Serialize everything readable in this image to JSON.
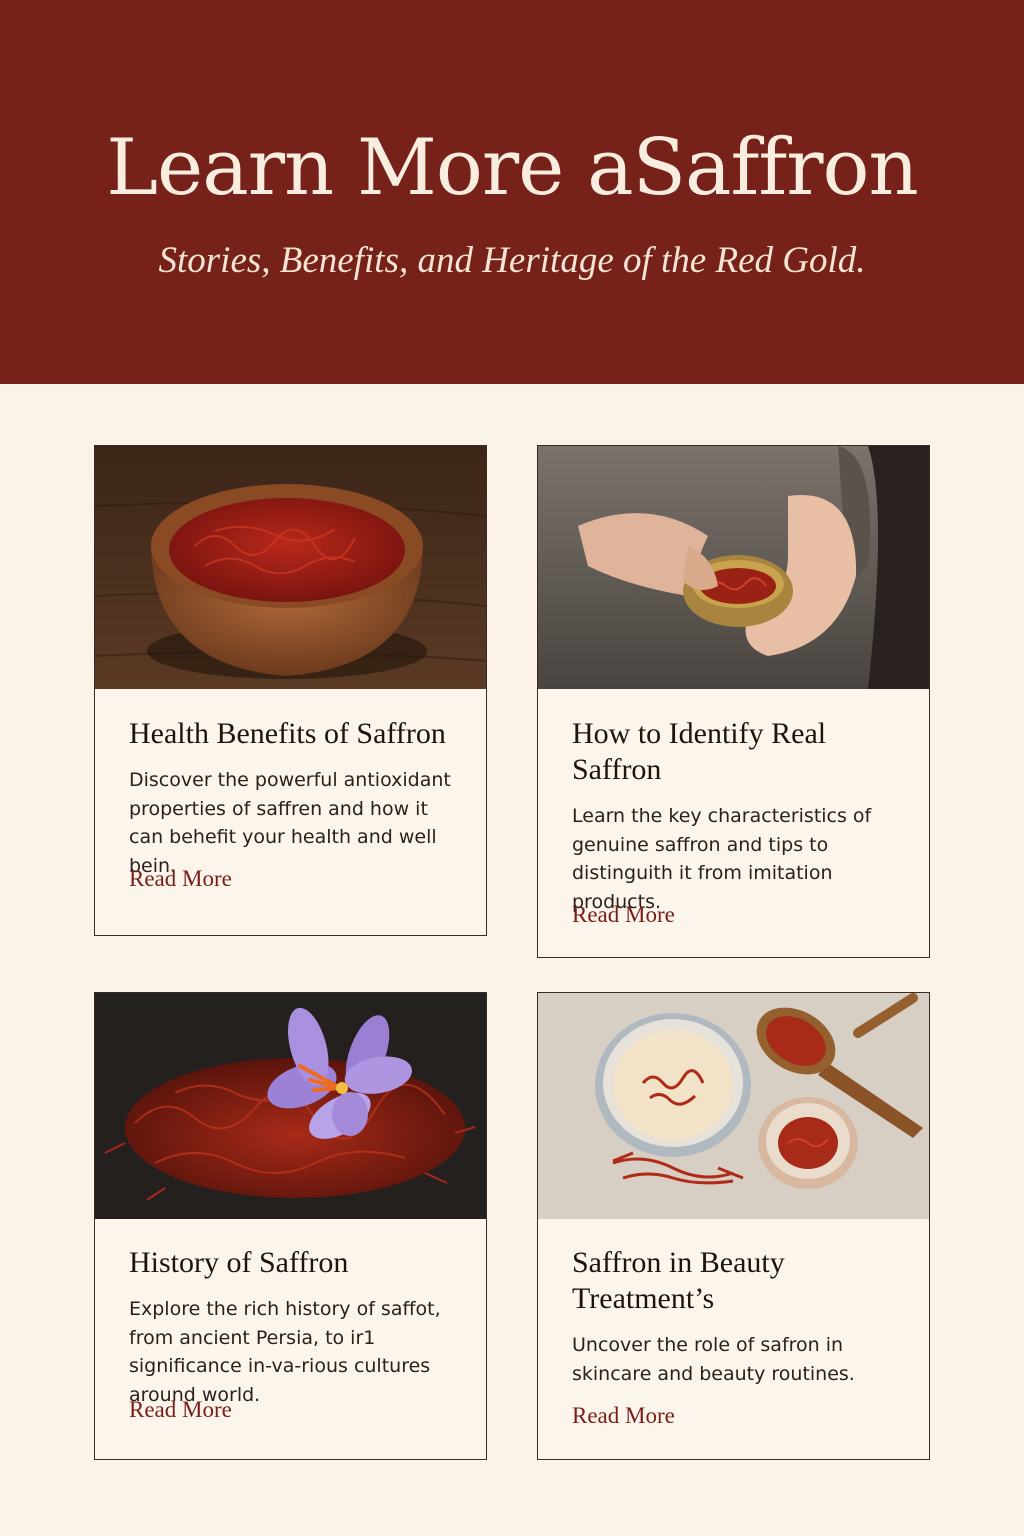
{
  "hero": {
    "title": "Learn More aSaffron",
    "subtitle": "Stories, Benefits, and Heritage of the Red Gold."
  },
  "cards": [
    {
      "title": "Health Benefits of Saffron",
      "description": "Discover the powerful antioxidant properties of saffren and how it can behefit your health and well bein.",
      "link": "Read More",
      "image": "saffron-bowl-image"
    },
    {
      "title": "How to Identify Real Saffron",
      "description": "Learn the key characteristics of genuine saffron and tips to distinguith it from imitation products.",
      "link": "Read More",
      "image": "hands-holding-saffron-image"
    },
    {
      "title": "History of Saffron",
      "description": "Explore the rich history of saffot, from ancient Persia, to ir1 significance in-va-rious cultures around world.",
      "link": "Read More",
      "image": "crocus-flower-saffron-image"
    },
    {
      "title": "Saffron in Beauty Treatment’s",
      "description": "Uncover the role of safron in skincare and beauty routines.",
      "link": "Read More",
      "image": "saffron-cream-bowls-image"
    }
  ],
  "colors": {
    "hero_background": "#76221a",
    "page_background": "#fbf3e8",
    "accent_link": "#7a1d17"
  }
}
